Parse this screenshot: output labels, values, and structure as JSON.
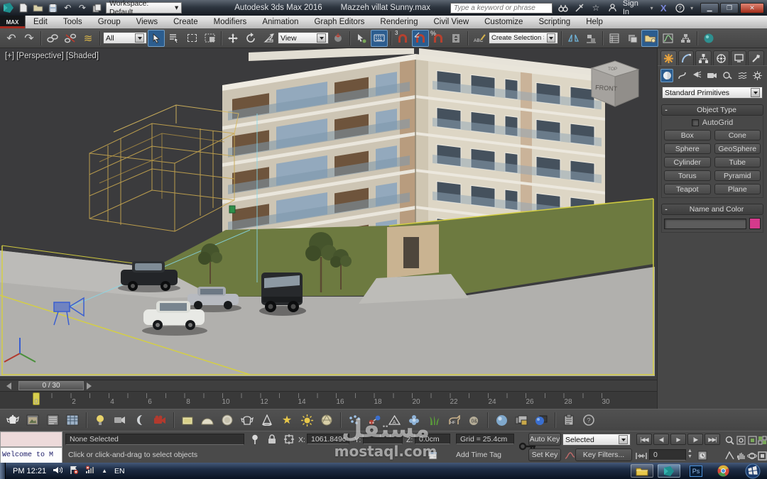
{
  "title_bar": {
    "workspace_label": "Workspace: Default",
    "app_title": "Autodesk 3ds Max 2016",
    "doc_name": "Mazzeh villat Sunny.max",
    "search_placeholder": "Type a keyword or phrase",
    "sign_in_label": "Sign In",
    "icons": [
      "max-logo",
      "new-scene",
      "open-file",
      "save-file",
      "undo-small",
      "redo-small",
      "project-toggle",
      "search-binoculars",
      "communication-center",
      "favorites-star",
      "sign-in-user",
      "exchange-apps",
      "help",
      "minimize",
      "maximize",
      "close"
    ]
  },
  "menu_bar": {
    "max_button": "MAX",
    "items": [
      "Edit",
      "Tools",
      "Group",
      "Views",
      "Create",
      "Modifiers",
      "Animation",
      "Graph Editors",
      "Rendering",
      "Civil View",
      "Customize",
      "Scripting",
      "Help"
    ]
  },
  "toolbar": {
    "selection_filter": "All",
    "coord_system": "View",
    "named_selection_placeholder": "Create Selection Se",
    "snap_mode_label": "3",
    "icons": [
      "undo",
      "redo",
      "select-and-link",
      "unlink-selection",
      "bind-to-space-warp",
      "select-object",
      "select-by-name",
      "rectangular-selection-region",
      "window-crossing-toggle",
      "select-and-move",
      "select-and-rotate",
      "select-and-scale",
      "use-pivot-point-center",
      "select-and-manipulate",
      "keyboard-shortcut-override",
      "snap-toggle-3d",
      "angle-snap-toggle",
      "percent-snap-toggle",
      "spinner-snap-toggle",
      "edit-named-selection-sets",
      "mirror",
      "align",
      "layer-manager",
      "scene-explorer",
      "ribbon-toggle",
      "curve-editor",
      "schematic-view",
      "render-setup"
    ]
  },
  "viewport": {
    "label": "[+] [Perspective] [Shaded]",
    "viewcube_front": "FRONT",
    "viewcube_top": "TOP"
  },
  "command_panel": {
    "tabs": [
      "create",
      "modify",
      "hierarchy",
      "motion",
      "display",
      "utilities"
    ],
    "sub_icons": [
      "geometry",
      "shapes",
      "lights",
      "cameras",
      "helpers",
      "space-warps",
      "systems"
    ],
    "primitive_category": "Standard Primitives",
    "object_type_rollout": {
      "collapse_glyph": "-",
      "title": "Object Type",
      "autogrid_label": "AutoGrid",
      "buttons": [
        "Box",
        "Cone",
        "Sphere",
        "GeoSphere",
        "Cylinder",
        "Tube",
        "Torus",
        "Pyramid",
        "Teapot",
        "Plane"
      ]
    },
    "name_color_rollout": {
      "collapse_glyph": "-",
      "title": "Name and Color",
      "name_value": "",
      "swatch_color": "#d53a8c"
    }
  },
  "timeline": {
    "slider_value": "0 / 30",
    "ticks": [
      "0",
      "2",
      "4",
      "6",
      "8",
      "10",
      "12",
      "14",
      "16",
      "18",
      "20",
      "22",
      "24",
      "26",
      "28",
      "30"
    ]
  },
  "shelf": {
    "icons": [
      "teapot-render",
      "rendered-frame",
      "light-lister",
      "table-grid",
      "light-bulb",
      "camera-speaker",
      "moon",
      "red-camera",
      "box",
      "dome",
      "sphere",
      "teapot",
      "cone",
      "star",
      "sun",
      "geosphere",
      "scatter",
      "molecule",
      "pyramid-a",
      "blob-flower",
      "grass",
      "hoofed-animal",
      "zero-sphere",
      "material-sphere",
      "image-stack",
      "sphere-box",
      "clipboard",
      "help-circle"
    ]
  },
  "status_bar": {
    "listener_text": "Welcome to M",
    "selection_status": "None Selected",
    "prompt_line": "Click or click-and-drag to select objects",
    "x_label": "X:",
    "x_value": "1061.849c",
    "y_label": "Y:",
    "y_value": "",
    "z_label": "Z:",
    "z_value": "0.0cm",
    "grid_value": "Grid = 25.4cm",
    "add_time_tag": "Add Time Tag",
    "auto_key_label": "Auto Key",
    "set_key_label": "Set Key",
    "key_mode_dropdown": "Selected",
    "key_filters_label": "Key Filters...",
    "frame_value": "0"
  },
  "taskbar": {
    "clock": "PM 12:21",
    "language": "EN",
    "photoshop_label": "Ps",
    "buttons": [
      "explorer",
      "3ds-max-active",
      "photoshop",
      "chrome",
      "start-orb"
    ]
  },
  "watermark": {
    "arabic": "مستقل",
    "domain": "mostaql.com"
  }
}
